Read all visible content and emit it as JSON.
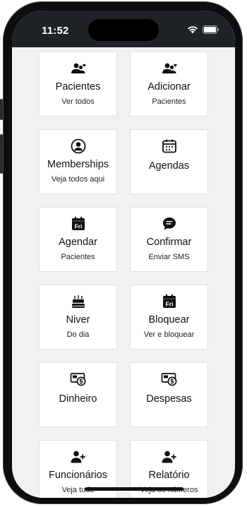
{
  "status_bar": {
    "time": "11:52"
  },
  "cards": [
    {
      "icon": "people-heart-icon",
      "title": "Pacientes",
      "subtitle": "Ver todos"
    },
    {
      "icon": "people-heart-icon",
      "title": "Adicionar",
      "subtitle": "Pacientes"
    },
    {
      "icon": "user-circle-icon",
      "title": "Memberships",
      "subtitle": "Veja todos aqui"
    },
    {
      "icon": "calendar-icon",
      "title": "Agendas",
      "subtitle": ""
    },
    {
      "icon": "calendar-fri-icon",
      "title": "Agendar",
      "subtitle": "Pacientes"
    },
    {
      "icon": "chat-bubble-icon",
      "title": "Confirmar",
      "subtitle": "Enviar SMS"
    },
    {
      "icon": "birthday-cake-icon",
      "title": "Niver",
      "subtitle": "Do dia"
    },
    {
      "icon": "calendar-fri-icon",
      "title": "Bloquear",
      "subtitle": "Ver e bloquear"
    },
    {
      "icon": "money-icon",
      "title": "Dinheiro",
      "subtitle": ""
    },
    {
      "icon": "money-icon",
      "title": "Despesas",
      "subtitle": ""
    },
    {
      "icon": "user-add-icon",
      "title": "Funcionários",
      "subtitle": "Veja tudo"
    },
    {
      "icon": "user-add-icon",
      "title": "Relatório",
      "subtitle": "Veja os números"
    }
  ],
  "icon_labels": {
    "fri": "Fri"
  }
}
